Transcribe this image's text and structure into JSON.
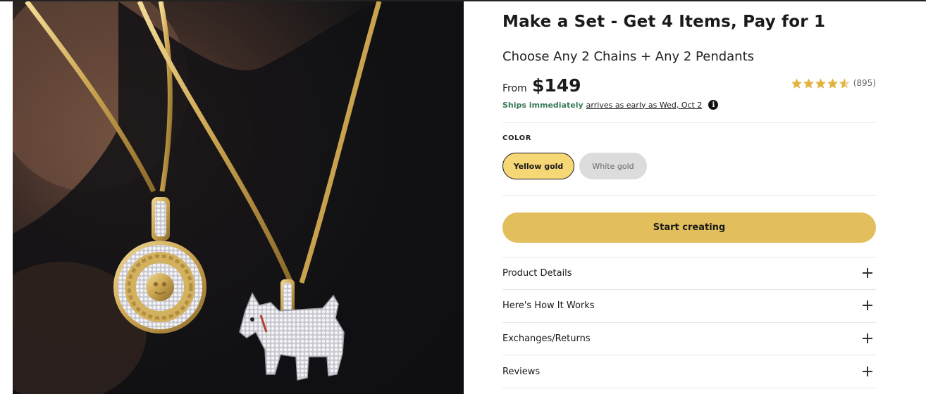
{
  "product": {
    "title": "Make a Set - Get 4 Items, Pay for 1",
    "subtitle": "Choose Any 2 Chains + Any 2 Pendants",
    "price_prefix": "From",
    "price": "$149",
    "rating": {
      "stars": 4.5,
      "count": "(895)",
      "star_color": "#e3b341"
    },
    "shipping": {
      "status": "Ships immediately",
      "eta": "arrives as early as Wed, Oct 2",
      "info_icon": "i",
      "status_color": "#3a7a57"
    }
  },
  "color_selector": {
    "label": "COLOR",
    "options": [
      {
        "label": "Yellow gold",
        "selected": true,
        "color": "#f6d776"
      },
      {
        "label": "White gold",
        "selected": false,
        "color": "#dcdcdc"
      }
    ]
  },
  "cta": {
    "label": "Start creating",
    "color": "#e3be5c"
  },
  "accordion": [
    {
      "label": "Product Details",
      "icon": "plus-icon"
    },
    {
      "label": "Here's How It Works",
      "icon": "plus-icon"
    },
    {
      "label": "Exchanges/Returns",
      "icon": "plus-icon"
    },
    {
      "label": "Reviews",
      "icon": "plus-icon"
    }
  ],
  "image": {
    "subject": "product-photo",
    "colors": {
      "background": "#151517",
      "gold": "#d4b15f",
      "silver": "#e8e8ec"
    }
  }
}
